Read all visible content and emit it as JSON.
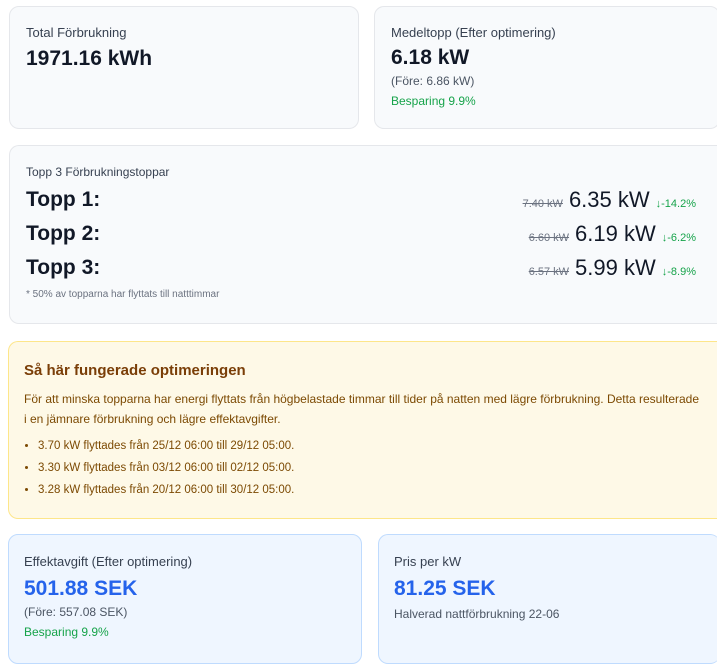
{
  "total": {
    "label": "Total Förbrukning",
    "value": "1971.16 kWh"
  },
  "avg_peak": {
    "label": "Medeltopp (Efter optimering)",
    "value": "6.18 kW",
    "before": "(Före: 6.86 kW)",
    "saving": "Besparing 9.9%"
  },
  "top3": {
    "label": "Topp 3 Förbrukningstoppar",
    "rows": [
      {
        "rank": "Topp 1:",
        "old": "7.40 kW",
        "new": "6.35 kW",
        "pct": "↓-14.2%"
      },
      {
        "rank": "Topp 2:",
        "old": "6.60 kW",
        "new": "6.19 kW",
        "pct": "↓-6.2%"
      },
      {
        "rank": "Topp 3:",
        "old": "6.57 kW",
        "new": "5.99 kW",
        "pct": "↓-8.9%"
      }
    ],
    "footnote": "* 50% av topparna har flyttats till natttimmar"
  },
  "info": {
    "title": "Så här fungerade optimeringen",
    "text": "För att minska topparna har energi flyttats från högbelastade timmar till tider på natten med lägre förbrukning. Detta resulterade i en jämnare förbrukning och lägre effektavgifter.",
    "items": [
      "3.70 kW flyttades från 25/12 06:00 till 29/12 05:00.",
      "3.30 kW flyttades från 03/12 06:00 till 02/12 05:00.",
      "3.28 kW flyttades från 20/12 06:00 till 30/12 05:00."
    ]
  },
  "fee": {
    "label": "Effektavgift (Efter optimering)",
    "value": "501.88 SEK",
    "before": "(Före: 557.08 SEK)",
    "saving": "Besparing 9.9%"
  },
  "price": {
    "label": "Pris per kW",
    "value": "81.25 SEK",
    "note": "Halverad nattförbrukning 22-06"
  },
  "colors": {
    "accent_blue": "#2563eb",
    "saving_green": "#16a34a",
    "info_bg": "#fef9e7",
    "info_text": "#7c4a03"
  }
}
